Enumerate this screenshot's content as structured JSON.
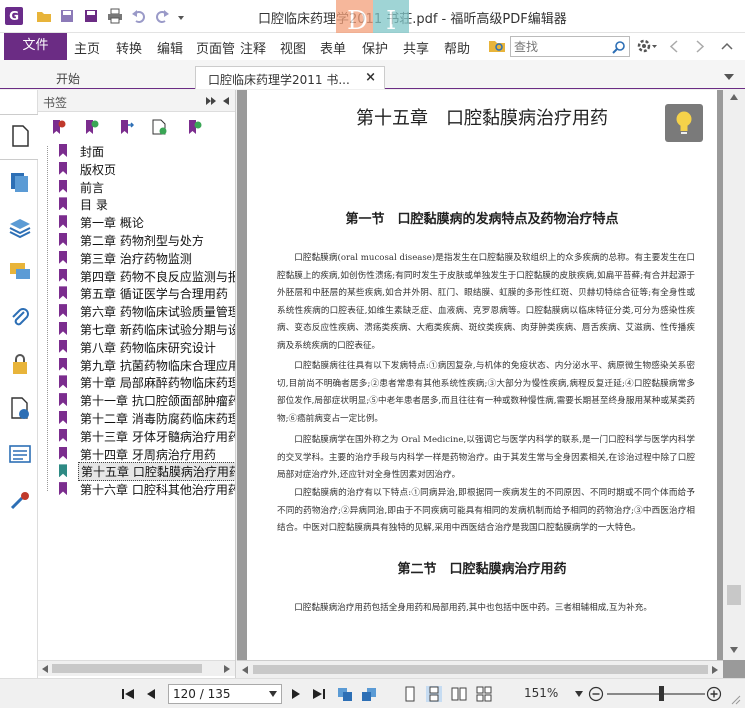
{
  "window": {
    "app_logo": "G",
    "title": "口腔临床药理学2011 书荘.pdf - 福昕高级PDF编辑器",
    "overlay_letters": [
      "D",
      "I"
    ]
  },
  "menu": {
    "file": "文件",
    "items": [
      "主页",
      "转换",
      "编辑",
      "页面管",
      "注释",
      "视图",
      "表单",
      "保护",
      "共享",
      "帮助"
    ],
    "search_placeholder": "查找"
  },
  "tabs": {
    "start": "开始",
    "doc": "口腔临床药理学2011 书...",
    "close": "×"
  },
  "bookmarks": {
    "title": "书签",
    "items": [
      "封面",
      "版权页",
      "前言",
      "目 录",
      "第一章 概论",
      "第二章 药物剂型与处方",
      "第三章 治疗药物监测",
      "第四章 药物不良反应监测与报",
      "第五章 循证医学与合理用药",
      "第六章 药物临床试验质量管理",
      "第七章 新药临床试验分期与设",
      "第八章 药物临床研究设计",
      "第九章 抗菌药物临床合理应用",
      "第十章 局部麻醉药物临床药理",
      "第十一章 抗口腔颌面部肿瘤药",
      "第十二章 消毒防腐药临床药理",
      "第十三章 牙体牙髓病治疗用药",
      "第十四章 牙周病治疗用药",
      "第十五章 口腔黏膜病治疗用药",
      "第十六章 口腔科其他治疗用药"
    ],
    "selected_index": 18
  },
  "document": {
    "chapter_title": "第十五章　口腔黏膜病治疗用药",
    "section1_title": "第一节　口腔黏膜病的发病特点及药物治疗特点",
    "para1": "口腔黏膜病(oral mucosal disease)是指发生在口腔黏膜及软组织上的众多疾病的总称。有主要发生在口腔黏膜上的疾病,如创伤性溃疡;有同时发生于皮肤或单独发生于口腔黏膜的皮肤疾病,如扁平苔藓;有合并起源于外胚层和中胚层的某些疾病,如合并外阴、肛门、眼结膜、虹膜的多形性红斑、贝赫切特综合征等;有全身性或系统性疾病的口腔表征,如维生素缺乏症、血液病、克罗恩病等。口腔黏膜病以临床特征分类,可分为感染性疾病、变态反应性疾病、溃疡类疾病、大疱类疾病、斑纹类疾病、肉芽肿类疾病、唇舌疾病、艾滋病、性传播疾病及系统疾病的口腔表征。",
    "para2": "口腔黏膜病往往具有以下发病特点:①病因复杂,与机体的免疫状态、内分泌水平、病原微生物感染关系密切,目前尚不明确者居多;②患者常患有其他系统性疾病;③大部分为慢性疾病,病程反复迁延;④口腔黏膜病常多部位发作,局部症状明显;⑤中老年患者居多,而且往往有一种或数种慢性病,需要长期甚至终身服用某种或某类药物;⑥癌前病变占一定比例。",
    "para3": "口腔黏膜病学在国外称之为 Oral Medicine,以强调它与医学内科学的联系,是一门口腔科学与医学内科学的交叉学科。主要的治疗手段与内科学一样是药物治疗。由于其发生常与全身因素相关,在诊治过程中除了口腔局部对症治疗外,还应针对全身性因素对因治疗。",
    "para4": "口腔黏膜病的治疗有以下特点:①同病异治,即根据同一疾病发生的不同原因、不同时期或不同个体而给予不同的药物治疗;②异病同治,即由于不同疾病可能具有相同的发病机制而给予相同的药物治疗;③中西医治疗相结合。中医对口腔黏膜病具有独特的见解,采用中西医结合治疗是我国口腔黏膜病学的一大特色。",
    "section2_title": "第二节　口腔黏膜病治疗用药",
    "para5": "口腔黏膜病治疗用药包括全身用药和局部用药,其中也包括中医中药。三者相辅相成,互为补充。"
  },
  "status": {
    "page_indicator": "120 / 135",
    "zoom": "151%"
  },
  "colors": {
    "brand": "#6b2c84",
    "bookmark_flag": "#7b2d8e",
    "selected_flag": "#2e8a84"
  }
}
